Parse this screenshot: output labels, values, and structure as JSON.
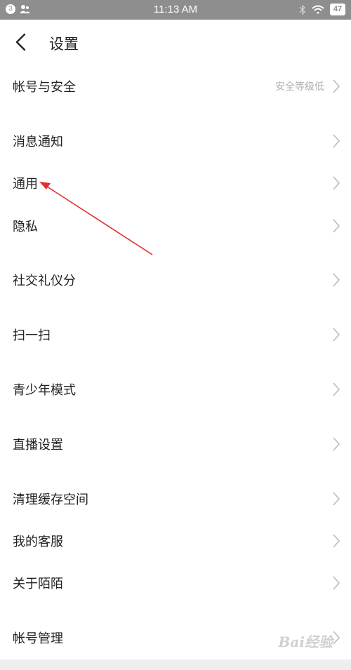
{
  "status_bar": {
    "time": "11:13 AM",
    "notification_count": "3",
    "battery": "47",
    "icons": [
      "contacts-icon",
      "bluetooth-icon",
      "wifi-icon",
      "battery-icon"
    ]
  },
  "header": {
    "title": "设置"
  },
  "settings": {
    "items": [
      {
        "label": "帐号与安全",
        "value": "安全等级低"
      },
      {
        "label": "消息通知"
      },
      {
        "label": "通用"
      },
      {
        "label": "隐私"
      },
      {
        "label": "社交礼仪分"
      },
      {
        "label": "扫一扫"
      },
      {
        "label": "青少年模式"
      },
      {
        "label": "直播设置"
      },
      {
        "label": "清理缓存空间"
      },
      {
        "label": "我的客服"
      },
      {
        "label": "关于陌陌"
      },
      {
        "label": "帐号管理"
      }
    ]
  },
  "watermark": {
    "text": "Bai经验"
  },
  "colors": {
    "annotation_arrow": "#e0302a",
    "status_bar": "#8e8e8e",
    "muted_text": "#b0b0b0"
  }
}
